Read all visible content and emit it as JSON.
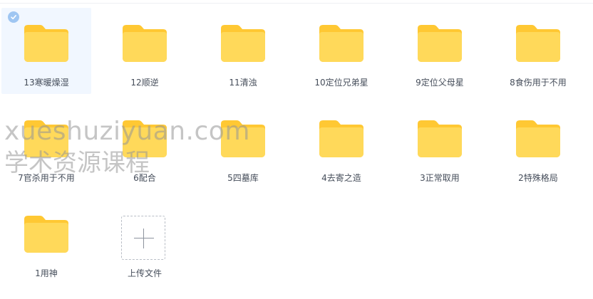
{
  "folders": [
    {
      "label": "13寒暖燥湿",
      "selected": true
    },
    {
      "label": "12顺逆",
      "selected": false
    },
    {
      "label": "11清浊",
      "selected": false
    },
    {
      "label": "10定位兄弟星",
      "selected": false
    },
    {
      "label": "9定位父母星",
      "selected": false
    },
    {
      "label": "8食伤用于不用",
      "selected": false
    },
    {
      "label": "7官杀用于不用",
      "selected": false
    },
    {
      "label": "6配合",
      "selected": false
    },
    {
      "label": "5四墓库",
      "selected": false
    },
    {
      "label": "4去寄之造",
      "selected": false
    },
    {
      "label": "3正常取用",
      "selected": false
    },
    {
      "label": "2特殊格局",
      "selected": false
    },
    {
      "label": "1用神",
      "selected": false
    }
  ],
  "upload": {
    "label": "上传文件",
    "icon": "plus-icon"
  },
  "watermark": {
    "line1": "xueshuziyuan.com",
    "line2": "学术资源课程"
  },
  "colors": {
    "folder_back": "#ffc833",
    "folder_front": "#ffd95a",
    "selected_bg": "#f1f7ff",
    "check": "#9fc6f2",
    "label_text": "#454d5a"
  }
}
